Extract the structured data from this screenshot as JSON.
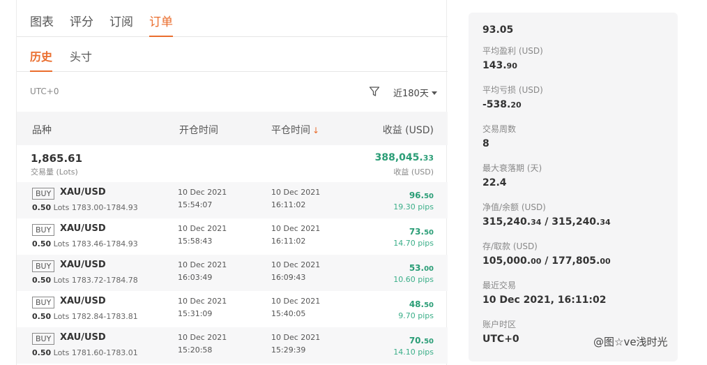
{
  "tabs": [
    "图表",
    "评分",
    "订阅",
    "订单"
  ],
  "subtabs": [
    "历史",
    "头寸"
  ],
  "timezone": "UTC+0",
  "range_label": "近180天",
  "columns": {
    "symbol": "品种",
    "open_time": "开仓时间",
    "close_time": "平仓时间",
    "sort_arrow": "↓",
    "profit": "收益 (USD)"
  },
  "summary": {
    "lots": "1,865.61",
    "lots_label": "交易量 (Lots)",
    "profit_int": "388,045.",
    "profit_dec": "33",
    "profit_label": "收益 (USD)"
  },
  "orders": [
    {
      "side": "BUY",
      "symbol": "XAU/USD",
      "lots": "0.50",
      "lots_unit": "Lots",
      "range": "1783.00-1784.93",
      "open_date": "10 Dec 2021",
      "open_time": "15:54:07",
      "close_date": "10 Dec 2021",
      "close_time": "16:11:02",
      "profit_int": "96.",
      "profit_dec": "50",
      "pips": "19.30 pips"
    },
    {
      "side": "BUY",
      "symbol": "XAU/USD",
      "lots": "0.50",
      "lots_unit": "Lots",
      "range": "1783.46-1784.93",
      "open_date": "10 Dec 2021",
      "open_time": "15:58:43",
      "close_date": "10 Dec 2021",
      "close_time": "16:11:02",
      "profit_int": "73.",
      "profit_dec": "50",
      "pips": "14.70 pips"
    },
    {
      "side": "BUY",
      "symbol": "XAU/USD",
      "lots": "0.50",
      "lots_unit": "Lots",
      "range": "1783.72-1784.78",
      "open_date": "10 Dec 2021",
      "open_time": "16:03:49",
      "close_date": "10 Dec 2021",
      "close_time": "16:09:43",
      "profit_int": "53.",
      "profit_dec": "00",
      "pips": "10.60 pips"
    },
    {
      "side": "BUY",
      "symbol": "XAU/USD",
      "lots": "0.50",
      "lots_unit": "Lots",
      "range": "1782.84-1783.81",
      "open_date": "10 Dec 2021",
      "open_time": "15:31:09",
      "close_date": "10 Dec 2021",
      "close_time": "15:40:05",
      "profit_int": "48.",
      "profit_dec": "50",
      "pips": "9.70 pips"
    },
    {
      "side": "BUY",
      "symbol": "XAU/USD",
      "lots": "0.50",
      "lots_unit": "Lots",
      "range": "1781.60-1783.01",
      "open_date": "10 Dec 2021",
      "open_time": "15:20:58",
      "close_date": "10 Dec 2021",
      "close_time": "15:29:39",
      "profit_int": "70.",
      "profit_dec": "50",
      "pips": "14.10 pips"
    }
  ],
  "stats": {
    "top_value": "93.05",
    "avg_profit_label": "平均盈利 (USD)",
    "avg_profit_int": "143.",
    "avg_profit_dec": "90",
    "avg_loss_label": "平均亏损 (USD)",
    "avg_loss_int": "-538.",
    "avg_loss_dec": "20",
    "weeks_label": "交易周数",
    "weeks_value": "8",
    "drawdown_label": "最大衰落期 (天)",
    "drawdown_value": "22.4",
    "equity_label": "净值/余额 (USD)",
    "equity_int": "315,240.",
    "equity_dec": "34",
    "equity_sep": " / ",
    "balance_int": "315,240.",
    "balance_dec": "34",
    "deposit_label": "存/取款 (USD)",
    "deposit_int": "105,000.",
    "deposit_dec": "00",
    "deposit_sep": " / ",
    "withdraw_int": "177,805.",
    "withdraw_dec": "00",
    "last_trade_label": "最近交易",
    "last_trade_value": "10 Dec 2021, 16:11:02",
    "tz_label": "账户时区",
    "tz_value": "UTC+0"
  },
  "watermark": "@图☆ve浅时光",
  "colors": {
    "accent": "#ea6d2d",
    "profit": "#2a9d76"
  }
}
